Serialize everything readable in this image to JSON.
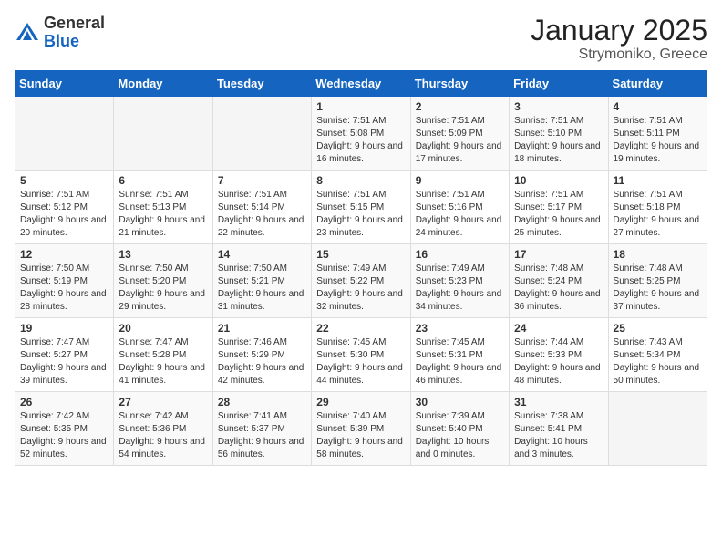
{
  "header": {
    "logo_general": "General",
    "logo_blue": "Blue",
    "month": "January 2025",
    "location": "Strymoniko, Greece"
  },
  "weekdays": [
    "Sunday",
    "Monday",
    "Tuesday",
    "Wednesday",
    "Thursday",
    "Friday",
    "Saturday"
  ],
  "weeks": [
    [
      {
        "day": "",
        "sunrise": "",
        "sunset": "",
        "daylight": ""
      },
      {
        "day": "",
        "sunrise": "",
        "sunset": "",
        "daylight": ""
      },
      {
        "day": "",
        "sunrise": "",
        "sunset": "",
        "daylight": ""
      },
      {
        "day": "1",
        "sunrise": "Sunrise: 7:51 AM",
        "sunset": "Sunset: 5:08 PM",
        "daylight": "Daylight: 9 hours and 16 minutes."
      },
      {
        "day": "2",
        "sunrise": "Sunrise: 7:51 AM",
        "sunset": "Sunset: 5:09 PM",
        "daylight": "Daylight: 9 hours and 17 minutes."
      },
      {
        "day": "3",
        "sunrise": "Sunrise: 7:51 AM",
        "sunset": "Sunset: 5:10 PM",
        "daylight": "Daylight: 9 hours and 18 minutes."
      },
      {
        "day": "4",
        "sunrise": "Sunrise: 7:51 AM",
        "sunset": "Sunset: 5:11 PM",
        "daylight": "Daylight: 9 hours and 19 minutes."
      }
    ],
    [
      {
        "day": "5",
        "sunrise": "Sunrise: 7:51 AM",
        "sunset": "Sunset: 5:12 PM",
        "daylight": "Daylight: 9 hours and 20 minutes."
      },
      {
        "day": "6",
        "sunrise": "Sunrise: 7:51 AM",
        "sunset": "Sunset: 5:13 PM",
        "daylight": "Daylight: 9 hours and 21 minutes."
      },
      {
        "day": "7",
        "sunrise": "Sunrise: 7:51 AM",
        "sunset": "Sunset: 5:14 PM",
        "daylight": "Daylight: 9 hours and 22 minutes."
      },
      {
        "day": "8",
        "sunrise": "Sunrise: 7:51 AM",
        "sunset": "Sunset: 5:15 PM",
        "daylight": "Daylight: 9 hours and 23 minutes."
      },
      {
        "day": "9",
        "sunrise": "Sunrise: 7:51 AM",
        "sunset": "Sunset: 5:16 PM",
        "daylight": "Daylight: 9 hours and 24 minutes."
      },
      {
        "day": "10",
        "sunrise": "Sunrise: 7:51 AM",
        "sunset": "Sunset: 5:17 PM",
        "daylight": "Daylight: 9 hours and 25 minutes."
      },
      {
        "day": "11",
        "sunrise": "Sunrise: 7:51 AM",
        "sunset": "Sunset: 5:18 PM",
        "daylight": "Daylight: 9 hours and 27 minutes."
      }
    ],
    [
      {
        "day": "12",
        "sunrise": "Sunrise: 7:50 AM",
        "sunset": "Sunset: 5:19 PM",
        "daylight": "Daylight: 9 hours and 28 minutes."
      },
      {
        "day": "13",
        "sunrise": "Sunrise: 7:50 AM",
        "sunset": "Sunset: 5:20 PM",
        "daylight": "Daylight: 9 hours and 29 minutes."
      },
      {
        "day": "14",
        "sunrise": "Sunrise: 7:50 AM",
        "sunset": "Sunset: 5:21 PM",
        "daylight": "Daylight: 9 hours and 31 minutes."
      },
      {
        "day": "15",
        "sunrise": "Sunrise: 7:49 AM",
        "sunset": "Sunset: 5:22 PM",
        "daylight": "Daylight: 9 hours and 32 minutes."
      },
      {
        "day": "16",
        "sunrise": "Sunrise: 7:49 AM",
        "sunset": "Sunset: 5:23 PM",
        "daylight": "Daylight: 9 hours and 34 minutes."
      },
      {
        "day": "17",
        "sunrise": "Sunrise: 7:48 AM",
        "sunset": "Sunset: 5:24 PM",
        "daylight": "Daylight: 9 hours and 36 minutes."
      },
      {
        "day": "18",
        "sunrise": "Sunrise: 7:48 AM",
        "sunset": "Sunset: 5:25 PM",
        "daylight": "Daylight: 9 hours and 37 minutes."
      }
    ],
    [
      {
        "day": "19",
        "sunrise": "Sunrise: 7:47 AM",
        "sunset": "Sunset: 5:27 PM",
        "daylight": "Daylight: 9 hours and 39 minutes."
      },
      {
        "day": "20",
        "sunrise": "Sunrise: 7:47 AM",
        "sunset": "Sunset: 5:28 PM",
        "daylight": "Daylight: 9 hours and 41 minutes."
      },
      {
        "day": "21",
        "sunrise": "Sunrise: 7:46 AM",
        "sunset": "Sunset: 5:29 PM",
        "daylight": "Daylight: 9 hours and 42 minutes."
      },
      {
        "day": "22",
        "sunrise": "Sunrise: 7:45 AM",
        "sunset": "Sunset: 5:30 PM",
        "daylight": "Daylight: 9 hours and 44 minutes."
      },
      {
        "day": "23",
        "sunrise": "Sunrise: 7:45 AM",
        "sunset": "Sunset: 5:31 PM",
        "daylight": "Daylight: 9 hours and 46 minutes."
      },
      {
        "day": "24",
        "sunrise": "Sunrise: 7:44 AM",
        "sunset": "Sunset: 5:33 PM",
        "daylight": "Daylight: 9 hours and 48 minutes."
      },
      {
        "day": "25",
        "sunrise": "Sunrise: 7:43 AM",
        "sunset": "Sunset: 5:34 PM",
        "daylight": "Daylight: 9 hours and 50 minutes."
      }
    ],
    [
      {
        "day": "26",
        "sunrise": "Sunrise: 7:42 AM",
        "sunset": "Sunset: 5:35 PM",
        "daylight": "Daylight: 9 hours and 52 minutes."
      },
      {
        "day": "27",
        "sunrise": "Sunrise: 7:42 AM",
        "sunset": "Sunset: 5:36 PM",
        "daylight": "Daylight: 9 hours and 54 minutes."
      },
      {
        "day": "28",
        "sunrise": "Sunrise: 7:41 AM",
        "sunset": "Sunset: 5:37 PM",
        "daylight": "Daylight: 9 hours and 56 minutes."
      },
      {
        "day": "29",
        "sunrise": "Sunrise: 7:40 AM",
        "sunset": "Sunset: 5:39 PM",
        "daylight": "Daylight: 9 hours and 58 minutes."
      },
      {
        "day": "30",
        "sunrise": "Sunrise: 7:39 AM",
        "sunset": "Sunset: 5:40 PM",
        "daylight": "Daylight: 10 hours and 0 minutes."
      },
      {
        "day": "31",
        "sunrise": "Sunrise: 7:38 AM",
        "sunset": "Sunset: 5:41 PM",
        "daylight": "Daylight: 10 hours and 3 minutes."
      },
      {
        "day": "",
        "sunrise": "",
        "sunset": "",
        "daylight": ""
      }
    ]
  ]
}
